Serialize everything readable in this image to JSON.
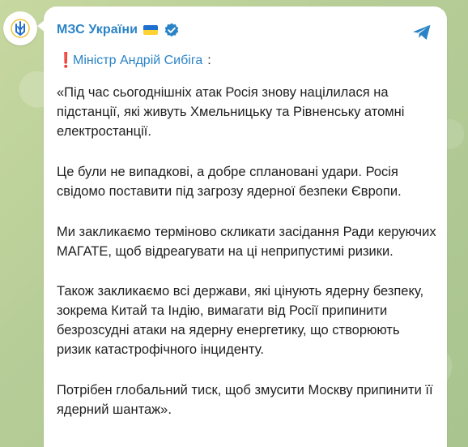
{
  "channel": {
    "name": "МЗС України",
    "flag_icon": "ukraine-flag-icon",
    "verified_icon": "verified-badge-icon",
    "share_icon": "send-share-icon"
  },
  "minister": {
    "alert_symbol": "❗",
    "label": "Міністр Андрій Сибіга",
    "suffix": ":"
  },
  "message": {
    "paragraphs": [
      "«Під час сьогоднішніх атак Росія знову націлилася на підстанції, які живуть Хмельницьку та Рівненську атомні електростанції.",
      "Це були не випадкові, а добре сплановані удари. Росія свідомо поставити під загрозу ядерної безпеки Європи.",
      "Ми закликаємо терміново скликати засідання Ради керуючих МАГАТЕ, щоб відреагувати на ці неприпустимі ризики.",
      "Також закликаємо всі держави, які цінують ядерну безпеку, зокрема Китай та Індію, вимагати від Росії припинити безрозсудні атаки на ядерну енергетику, що створюють ризик катастрофічного інциденту.",
      "Потрібен глобальний тиск, щоб змусити Москву припинити її ядерний шантаж»."
    ]
  },
  "colors": {
    "accent_blue": "#2a83c6",
    "text_dark": "#1f1f1f",
    "alert_red": "#d9342b",
    "flag_blue": "#1f6fd0",
    "flag_yellow": "#ffd233"
  }
}
